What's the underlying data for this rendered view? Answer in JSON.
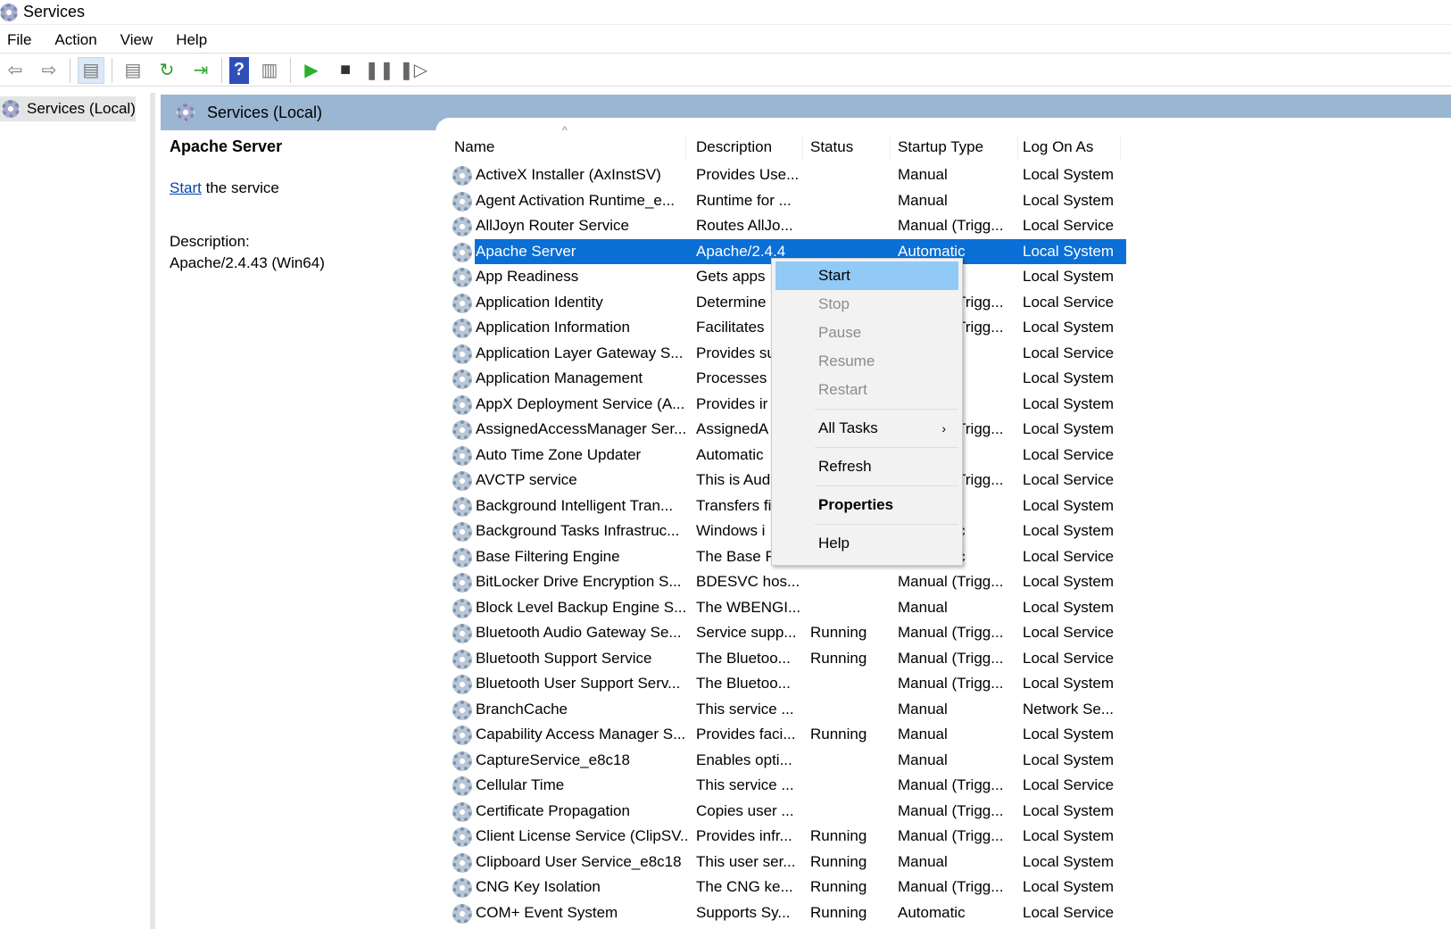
{
  "window": {
    "title": "Services"
  },
  "menubar": [
    "File",
    "Action",
    "View",
    "Help"
  ],
  "toolbar": {
    "icons": [
      "back-arrow-icon",
      "forward-arrow-icon",
      "show-hide-console-tree-icon",
      "properties-icon",
      "refresh-icon",
      "export-list-icon",
      "help-icon",
      "show-action-pane-icon",
      "start-service-icon",
      "stop-service-icon",
      "pause-service-icon",
      "resume-service-icon"
    ]
  },
  "tree": {
    "root": "Services (Local)"
  },
  "pane": {
    "title": "Services (Local)"
  },
  "detail": {
    "name": "Apache Server",
    "start_link": "Start",
    "start_rest": " the service",
    "desc_label": "Description:",
    "desc_value": "Apache/2.4.43 (Win64)"
  },
  "columns": [
    "Name",
    "Description",
    "Status",
    "Startup Type",
    "Log On As"
  ],
  "rows": [
    [
      "ActiveX Installer (AxInstSV)",
      "Provides Use...",
      "",
      "Manual",
      "Local System"
    ],
    [
      "Agent Activation Runtime_e...",
      "Runtime for ...",
      "",
      "Manual",
      "Local System"
    ],
    [
      "AllJoyn Router Service",
      "Routes AllJo...",
      "",
      "Manual (Trigg...",
      "Local Service"
    ],
    [
      "Apache Server",
      "Apache/2.4.4",
      "",
      "Automatic",
      "Local System"
    ],
    [
      "App Readiness",
      "Gets apps",
      "",
      "",
      "Local System"
    ],
    [
      "Application Identity",
      "Determine",
      "",
      "Manual (Trigg...",
      "Local Service"
    ],
    [
      "Application Information",
      "Facilitates",
      "",
      "Manual (Trigg...",
      "Local System"
    ],
    [
      "Application Layer Gateway S...",
      "Provides su",
      "",
      "",
      "Local Service"
    ],
    [
      "Application Management",
      "Processes i",
      "",
      "",
      "Local System"
    ],
    [
      "AppX Deployment Service (A...",
      "Provides ir",
      "",
      "",
      "Local System"
    ],
    [
      "AssignedAccessManager Ser...",
      "AssignedA",
      "",
      "Manual (Trigg...",
      "Local System"
    ],
    [
      "Auto Time Zone Updater",
      "Automatic",
      "",
      "",
      "Local Service"
    ],
    [
      "AVCTP service",
      "This is Aud",
      "",
      "Manual (Trigg...",
      "Local Service"
    ],
    [
      "Background Intelligent Tran...",
      "Transfers fi",
      "",
      "",
      "Local System"
    ],
    [
      "Background Tasks Infrastruc...",
      "Windows i",
      "",
      "Automatic",
      "Local System"
    ],
    [
      "Base Filtering Engine",
      "The Base F",
      "",
      "Automatic",
      "Local Service"
    ],
    [
      "BitLocker Drive Encryption S...",
      "BDESVC hos...",
      "",
      "Manual (Trigg...",
      "Local System"
    ],
    [
      "Block Level Backup Engine S...",
      "The WBENGI...",
      "",
      "Manual",
      "Local System"
    ],
    [
      "Bluetooth Audio Gateway Se...",
      "Service supp...",
      "Running",
      "Manual (Trigg...",
      "Local Service"
    ],
    [
      "Bluetooth Support Service",
      "The Bluetoo...",
      "Running",
      "Manual (Trigg...",
      "Local Service"
    ],
    [
      "Bluetooth User Support Serv...",
      "The Bluetoo...",
      "",
      "Manual (Trigg...",
      "Local System"
    ],
    [
      "BranchCache",
      "This service ...",
      "",
      "Manual",
      "Network Se..."
    ],
    [
      "Capability Access Manager S...",
      "Provides faci...",
      "Running",
      "Manual",
      "Local System"
    ],
    [
      "CaptureService_e8c18",
      "Enables opti...",
      "",
      "Manual",
      "Local System"
    ],
    [
      "Cellular Time",
      "This service ...",
      "",
      "Manual (Trigg...",
      "Local Service"
    ],
    [
      "Certificate Propagation",
      "Copies user ...",
      "",
      "Manual (Trigg...",
      "Local System"
    ],
    [
      "Client License Service (ClipSV...",
      "Provides infr...",
      "Running",
      "Manual (Trigg...",
      "Local System"
    ],
    [
      "Clipboard User Service_e8c18",
      "This user ser...",
      "Running",
      "Manual",
      "Local System"
    ],
    [
      "CNG Key Isolation",
      "The CNG ke...",
      "Running",
      "Manual (Trigg...",
      "Local System"
    ],
    [
      "COM+ Event System",
      "Supports Sy...",
      "Running",
      "Automatic",
      "Local Service"
    ]
  ],
  "selected_row": 3,
  "context_menu": {
    "start": "Start",
    "stop": "Stop",
    "pause": "Pause",
    "resume": "Resume",
    "restart": "Restart",
    "all_tasks": "All Tasks",
    "refresh": "Refresh",
    "properties": "Properties",
    "help": "Help"
  },
  "colors": {
    "selection": "#0a6fd6",
    "menu_highlight": "#91c9f7",
    "pane_header": "#9bb6d3"
  }
}
